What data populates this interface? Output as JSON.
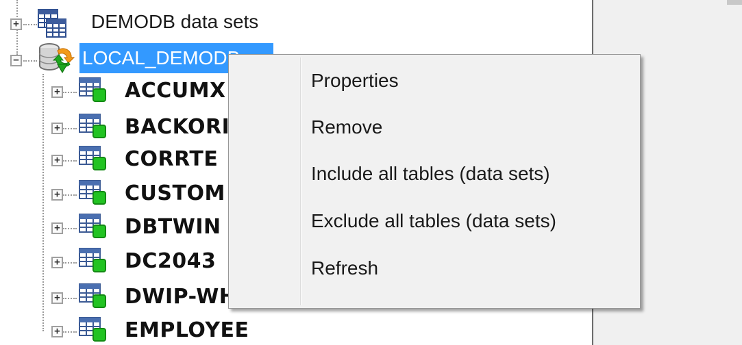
{
  "tree": {
    "root1": {
      "label": "DEMODB data sets",
      "expander": "+",
      "icon": "dataset-grid-icon"
    },
    "root2": {
      "label": "LOCAL_DEMODB",
      "expander": "−",
      "icon": "database-sync-icon",
      "selected": true
    },
    "tables": [
      {
        "label": "ACCUMX",
        "expander": "+",
        "icon": "table-green-icon"
      },
      {
        "label": "BACKORI",
        "expander": "+",
        "icon": "table-green-icon"
      },
      {
        "label": "CORRTE",
        "expander": "+",
        "icon": "table-green-icon"
      },
      {
        "label": "CUSTOM",
        "expander": "+",
        "icon": "table-green-icon"
      },
      {
        "label": "DBTWIN",
        "expander": "+",
        "icon": "table-green-icon"
      },
      {
        "label": "DC2043",
        "expander": "+",
        "icon": "table-green-icon"
      },
      {
        "label": "DWIP-WHK-ITM-FIG",
        "expander": "+",
        "icon": "table-green-icon"
      },
      {
        "label": "EMPLOYEE",
        "expander": "+",
        "icon": "table-green-icon"
      }
    ]
  },
  "context_menu": {
    "items": [
      {
        "label": "Properties"
      },
      {
        "label": "Remove"
      },
      {
        "label": "Include all tables (data sets)"
      },
      {
        "label": "Exclude all tables (data sets)"
      },
      {
        "label": "Refresh"
      }
    ]
  },
  "colors": {
    "selection": "#3399ff",
    "table_badge": "#22c322",
    "menu_bg": "#f1f1f1",
    "pane_bg": "#f0f0f0"
  }
}
